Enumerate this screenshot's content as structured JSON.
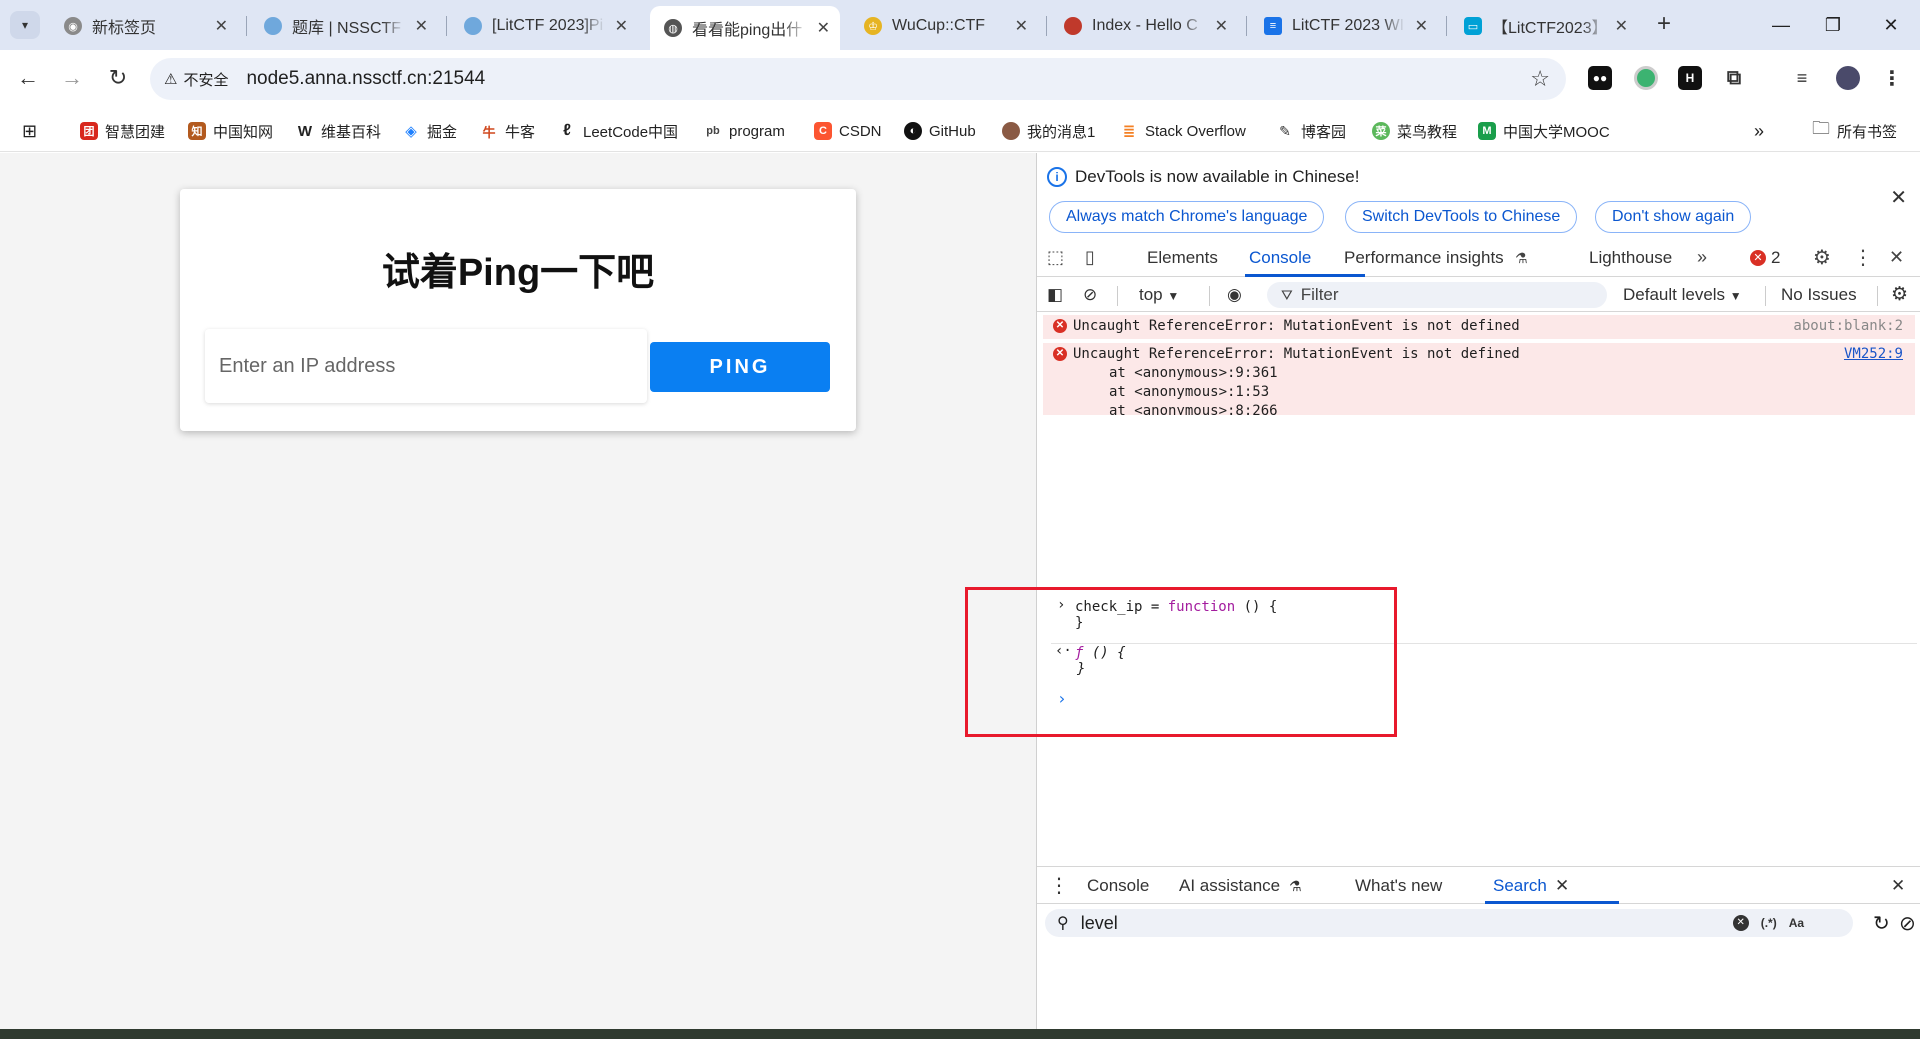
{
  "tabs": [
    {
      "title": "新标签页",
      "favicon": "chrome-icon",
      "color": "#7a7a7a"
    },
    {
      "title": "题库 | NSSCTF",
      "favicon": "nssctf-icon",
      "color": "#6fa8dc"
    },
    {
      "title": "[LitCTF 2023]Pi",
      "favicon": "nssctf-icon",
      "color": "#6fa8dc"
    },
    {
      "title": "看看能ping出什",
      "favicon": "globe-icon",
      "color": "#555555"
    },
    {
      "title": "WuCup::CTF",
      "favicon": "trophy-icon",
      "color": "#e6b422"
    },
    {
      "title": "Index - Hello C",
      "favicon": "ctf-icon",
      "color": "#c0392b"
    },
    {
      "title": "LitCTF 2023 WI",
      "favicon": "doc-icon",
      "color": "#1a73e8"
    },
    {
      "title": "【LitCTF2023】",
      "favicon": "bilibili-icon",
      "color": "#00a1d6"
    }
  ],
  "address": {
    "security_label": "不安全",
    "url": "node5.anna.nssctf.cn:21544"
  },
  "bookmarks": [
    {
      "label": "智慧团建",
      "icon": "tuanjian-icon",
      "color": "#d8281e"
    },
    {
      "label": "中国知网",
      "icon": "cnki-icon",
      "color": "#b35a1f"
    },
    {
      "label": "维基百科",
      "icon": "wikipedia-icon",
      "color": "#222222"
    },
    {
      "label": "掘金",
      "icon": "juejin-icon",
      "color": "#1e80ff"
    },
    {
      "label": "牛客",
      "icon": "nowcoder-icon",
      "color": "#d0491f"
    },
    {
      "label": "LeetCode中国",
      "icon": "leetcode-icon",
      "color": "#222222"
    },
    {
      "label": "program",
      "icon": "program-icon",
      "color": "#444444"
    },
    {
      "label": "CSDN",
      "icon": "csdn-icon",
      "color": "#fc5531"
    },
    {
      "label": "GitHub",
      "icon": "github-icon",
      "color": "#111111"
    },
    {
      "label": "我的消息1",
      "icon": "avatar-icon",
      "color": "#8a5a44"
    },
    {
      "label": "Stack Overflow",
      "icon": "stackoverflow-icon",
      "color": "#f48024"
    },
    {
      "label": "博客园",
      "icon": "cnblogs-icon",
      "color": "#333333"
    },
    {
      "label": "菜鸟教程",
      "icon": "runoob-icon",
      "color": "#5cb85c"
    },
    {
      "label": "中国大学MOOC",
      "icon": "mooc-icon",
      "color": "#1a9e4b"
    }
  ],
  "bookmarks_all_label": "所有书签",
  "page": {
    "heading": "试着Ping一下吧",
    "ip_placeholder": "Enter an IP address",
    "ping_label": "PING"
  },
  "devtools": {
    "info_message": "DevTools is now available in Chinese!",
    "info_buttons": [
      "Always match Chrome's language",
      "Switch DevTools to Chinese",
      "Don't show again"
    ],
    "tabs": [
      "Elements",
      "Console",
      "Performance insights",
      "Lighthouse"
    ],
    "active_tab": "Console",
    "error_count": "2",
    "context": "top",
    "filter_placeholder": "Filter",
    "levels": "Default levels",
    "issues": "No Issues",
    "errors": [
      {
        "message": "Uncaught ReferenceError: MutationEvent is not defined",
        "source": "about:blank:2"
      },
      {
        "message": "Uncaught ReferenceError: MutationEvent is not defined",
        "source": "VM252:9",
        "stack": [
          "at <anonymous>:9:361",
          "at <anonymous>:1:53",
          "at <anonymous>:8:266"
        ]
      }
    ],
    "command": {
      "line1_ident": "check_ip = ",
      "line1_kw": "function",
      "line1_rest": " () {",
      "line2": "}"
    },
    "result": {
      "line1_f": "ƒ",
      "line1_rest": " () {",
      "line2": "}"
    },
    "drawer_tabs": [
      "Console",
      "AI assistance",
      "What's new",
      "Search"
    ],
    "drawer_active": "Search",
    "search_value": "level"
  },
  "colors": {
    "accent": "#0b57d0",
    "ping_button": "#0a7ff2",
    "error_bg": "#fce8e8",
    "highlight_box": "#e8192c"
  }
}
